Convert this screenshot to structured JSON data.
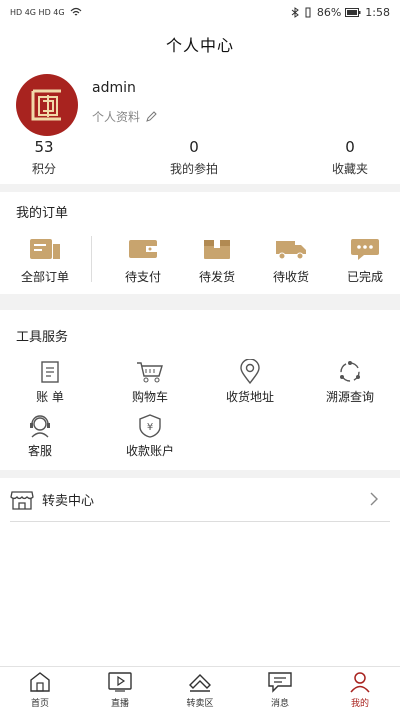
{
  "status_bar": {
    "carrier_icons": "HD  4G  HD  4G",
    "right_text": "86%",
    "time": "1:58"
  },
  "header": {
    "title": "个人中心"
  },
  "profile": {
    "username": "admin",
    "profile_link": "个人资料",
    "stats": [
      {
        "value": "53",
        "label": "积分"
      },
      {
        "value": "0",
        "label": "我的参拍"
      },
      {
        "value": "0",
        "label": "收藏夹"
      }
    ]
  },
  "orders": {
    "title": "我的订单",
    "items": [
      {
        "label": "全部订单",
        "icon": "all-orders-icon"
      },
      {
        "label": "待支付",
        "icon": "wallet-icon"
      },
      {
        "label": "待发货",
        "icon": "box-icon"
      },
      {
        "label": "待收货",
        "icon": "truck-icon"
      },
      {
        "label": "已完成",
        "icon": "chat-icon"
      }
    ]
  },
  "tools": {
    "title": "工具服务",
    "items": [
      {
        "label": "账 单",
        "icon": "bill-icon"
      },
      {
        "label": "购物车",
        "icon": "cart-icon"
      },
      {
        "label": "收货地址",
        "icon": "location-icon"
      },
      {
        "label": "溯源查询",
        "icon": "trace-icon"
      },
      {
        "label": "客服",
        "icon": "service-icon"
      },
      {
        "label": "收款账户",
        "icon": "account-icon"
      }
    ]
  },
  "resale": {
    "label": "转卖中心"
  },
  "tabbar": {
    "items": [
      {
        "label": "首页"
      },
      {
        "label": "直播"
      },
      {
        "label": "转卖区"
      },
      {
        "label": "消息"
      },
      {
        "label": "我的"
      }
    ],
    "active_index": 4
  },
  "colors": {
    "brand": "#a8231f",
    "icon_gold": "#c8a46e"
  }
}
